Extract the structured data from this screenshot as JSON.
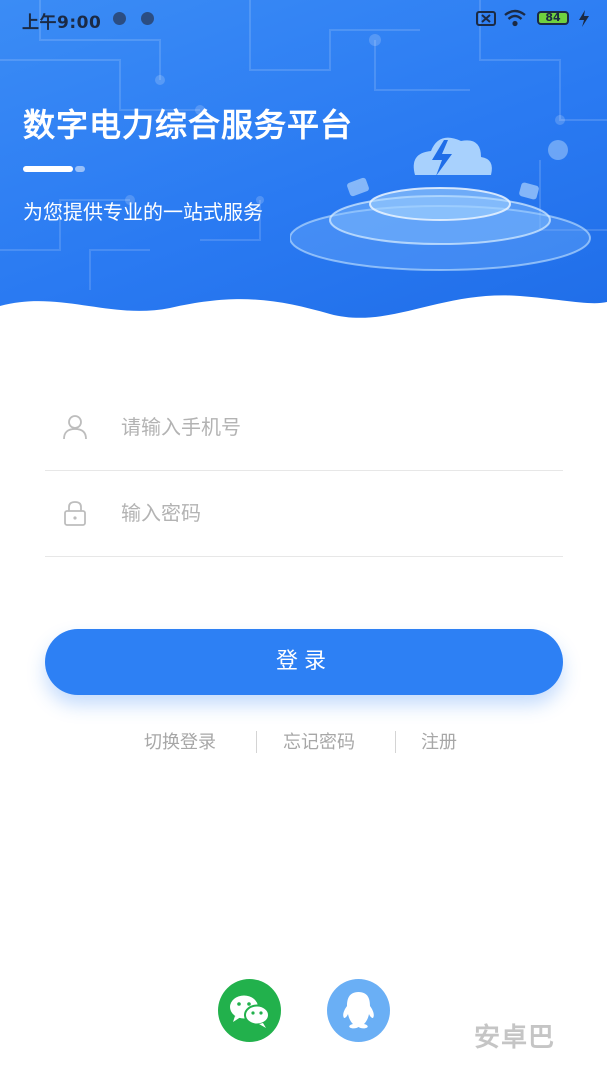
{
  "status_bar": {
    "time": "上午9:00",
    "battery": "84"
  },
  "hero": {
    "title": "数字电力综合服务平台",
    "subtitle": "为您提供专业的一站式服务"
  },
  "form": {
    "phone_placeholder": "请输入手机号",
    "password_placeholder": "输入密码",
    "login_label": "登录"
  },
  "links": {
    "switch_login": "切换登录",
    "forgot_password": "忘记密码",
    "register": "注册"
  },
  "social": [
    {
      "icon": "wechat-icon",
      "color": "#22b14c"
    },
    {
      "icon": "qq-icon",
      "color": "#6aaff5"
    }
  ],
  "watermark": "安卓巴",
  "colors": {
    "primary": "#2d80f4",
    "hero": "#2a7af2"
  }
}
